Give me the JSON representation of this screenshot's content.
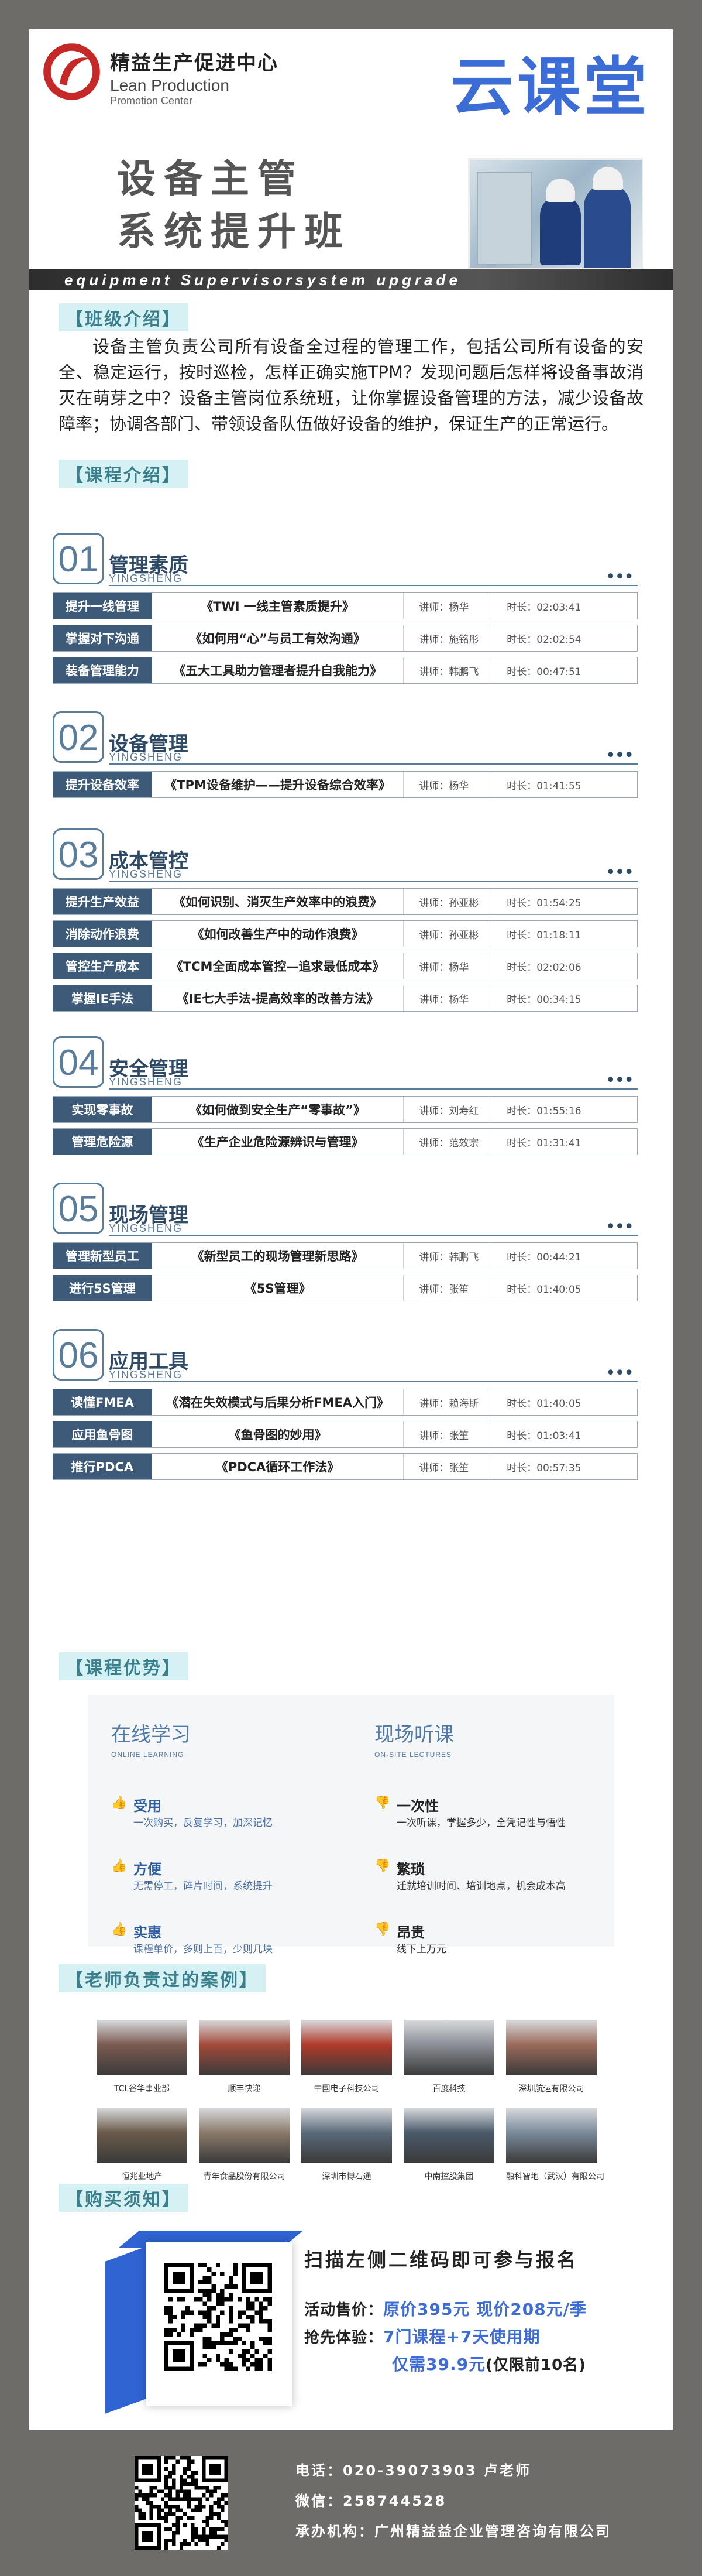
{
  "header": {
    "org_cn": "精益生产促进中心",
    "org_en1": "Lean Production",
    "org_en2": "Promotion Center",
    "platform": "云课堂",
    "title_line1": "设备主管",
    "title_line2": "系统提升班",
    "banner_en": "equipment Supervisorsystem upgrade"
  },
  "intro": {
    "tag": "【班级介绍】",
    "text": "设备主管负责公司所有设备全过程的管理工作，包括公司所有设备的安全、稳定运行，按时巡检，怎样正确实施TPM？发现问题后怎样将设备事故消灭在萌芽之中？设备主管岗位系统班，让你掌握设备管理的方法，减少设备故障率；协调各部门、带领设备队伍做好设备的维护，保证生产的正常运行。"
  },
  "courses": {
    "tag": "【课程介绍】",
    "modules": [
      {
        "num": "01",
        "title": "管理素质",
        "sub": "YINGSHENG",
        "rows": [
          {
            "tag": "提升一线管理",
            "course": "《TWI 一线主管素质提升》",
            "teacher": "讲师：杨华",
            "time": "时长：02:03:41"
          },
          {
            "tag": "掌握对下沟通",
            "course": "《如何用“心”与员工有效沟通》",
            "teacher": "讲师：施铭彤",
            "time": "时长：02:02:54"
          },
          {
            "tag": "装备管理能力",
            "course": "《五大工具助力管理者提升自我能力》",
            "teacher": "讲师：韩鹏飞",
            "time": "时长：00:47:51"
          }
        ]
      },
      {
        "num": "02",
        "title": "设备管理",
        "sub": "YINGSHENG",
        "rows": [
          {
            "tag": "提升设备效率",
            "course": "《TPM设备维护——提升设备综合效率》",
            "teacher": "讲师：杨华",
            "time": "时长：01:41:55"
          }
        ]
      },
      {
        "num": "03",
        "title": "成本管控",
        "sub": "YINGSHENG",
        "rows": [
          {
            "tag": "提升生产效益",
            "course": "《如何识别、消灭生产效率中的浪费》",
            "teacher": "讲师：孙亚彬",
            "time": "时长：01:54:25"
          },
          {
            "tag": "消除动作浪费",
            "course": "《如何改善生产中的动作浪费》",
            "teacher": "讲师：孙亚彬",
            "time": "时长：01:18:11"
          },
          {
            "tag": "管控生产成本",
            "course": "《TCM全面成本管控—追求最低成本》",
            "teacher": "讲师：杨华",
            "time": "时长：02:02:06"
          },
          {
            "tag": "掌握IE手法",
            "course": "《IE七大手法-提高效率的改善方法》",
            "teacher": "讲师：杨华",
            "time": "时长：00:34:15"
          }
        ]
      },
      {
        "num": "04",
        "title": "安全管理",
        "sub": "YINGSHENG",
        "rows": [
          {
            "tag": "实现零事故",
            "course": "《如何做到安全生产“零事故”》",
            "teacher": "讲师：刘寿红",
            "time": "时长：01:55:16"
          },
          {
            "tag": "管理危险源",
            "course": "《生产企业危险源辨识与管理》",
            "teacher": "讲师：范效宗",
            "time": "时长：01:31:41"
          }
        ]
      },
      {
        "num": "05",
        "title": "现场管理",
        "sub": "YINGSHENG",
        "rows": [
          {
            "tag": "管理新型员工",
            "course": "《新型员工的现场管理新思路》",
            "teacher": "讲师：韩鹏飞",
            "time": "时长：00:44:21"
          },
          {
            "tag": "进行5S管理",
            "course": "《5S管理》",
            "teacher": "讲师：张笙",
            "time": "时长：01:40:05"
          }
        ]
      },
      {
        "num": "06",
        "title": "应用工具",
        "sub": "YINGSHENG",
        "rows": [
          {
            "tag": "读懂FMEA",
            "course": "《潜在失效模式与后果分析FMEA入门》",
            "teacher": "讲师：赖海斯",
            "time": "时长：01:40:05"
          },
          {
            "tag": "应用鱼骨图",
            "course": "《鱼骨图的妙用》",
            "teacher": "讲师：张笙",
            "time": "时长：01:03:41"
          },
          {
            "tag": "推行PDCA",
            "course": "《PDCA循环工作法》",
            "teacher": "讲师：张笙",
            "time": "时长：00:57:35"
          }
        ]
      }
    ]
  },
  "advantages": {
    "tag": "【课程优势】",
    "online": {
      "title": "在线学习",
      "en": "ONLINE LEARNING",
      "items": [
        {
          "t": "受用",
          "d": "一次购买，反复学习，加深记忆"
        },
        {
          "t": "方便",
          "d": "无需停工，碎片时间，系统提升"
        },
        {
          "t": "实惠",
          "d": "课程单价，多则上百，少则几块"
        }
      ]
    },
    "onsite": {
      "title": "现场听课",
      "en": "ON-SITE LECTURES",
      "items": [
        {
          "t": "一次性",
          "d": "一次听课，掌握多少，全凭记性与悟性"
        },
        {
          "t": "繁琐",
          "d": "迁就培训时间、培训地点，机会成本高"
        },
        {
          "t": "昂贵",
          "d": "线下上万元"
        }
      ]
    }
  },
  "cases": {
    "tag": "【老师负责过的案例】",
    "items": [
      {
        "label": "TCL谷华事业部",
        "color": "#7a5a50"
      },
      {
        "label": "顺丰快递",
        "color": "#a34a3a"
      },
      {
        "label": "中国电子科技公司",
        "color": "#b03a2a"
      },
      {
        "label": "百度科技",
        "color": "#8a8f96"
      },
      {
        "label": "深圳航运有限公司",
        "color": "#9a6a5a"
      },
      {
        "label": "恒兆业地产",
        "color": "#6a5a4a"
      },
      {
        "label": "青年食品股份有限公司",
        "color": "#8a7a6a"
      },
      {
        "label": "深圳市博石通",
        "color": "#5a6a7a"
      },
      {
        "label": "中南控股集团",
        "color": "#4a5a6a"
      },
      {
        "label": "融科智地（武汉）有限公司",
        "color": "#7a8a9a"
      }
    ]
  },
  "purchase": {
    "tag": "【购买须知】",
    "headline": "扫描左侧二维码即可参与报名",
    "price_label": "活动售价：",
    "price": "原价395元 现价208元/季",
    "trial_label": "抢先体验：",
    "trial": "7门课程+7天使用期",
    "trial_price": "仅需39.9元",
    "trial_note": "(仅限前10名)"
  },
  "footer": {
    "phone": "电话：020-39073903 卢老师",
    "wechat": "微信：258744528",
    "org": "承办机构：广州精益益企业管理咨询有限公司"
  },
  "colors": {
    "brand_blue": "#3c6cd6",
    "navy": "#3d5a78",
    "teal_tag": "#d6f1f4",
    "logo_red": "#c62828"
  }
}
